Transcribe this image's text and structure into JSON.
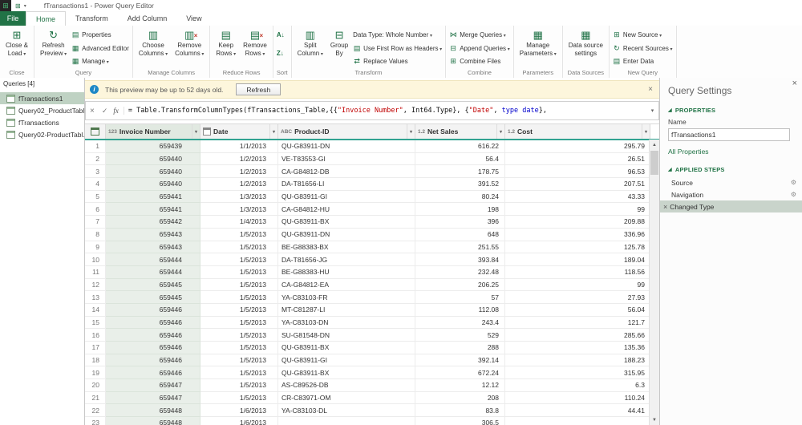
{
  "titlebar": {
    "title": "fTransactions1 - Power Query Editor"
  },
  "menu": {
    "file": "File",
    "tabs": [
      "Home",
      "Transform",
      "Add Column",
      "View"
    ],
    "active_tab": "Home"
  },
  "ribbon": {
    "close_load": [
      "Close &",
      "Load"
    ],
    "refresh_preview": [
      "Refresh",
      "Preview"
    ],
    "properties": "Properties",
    "advanced_editor": "Advanced Editor",
    "manage": "Manage",
    "choose_columns": [
      "Choose",
      "Columns"
    ],
    "remove_columns": [
      "Remove",
      "Columns"
    ],
    "keep_rows": [
      "Keep",
      "Rows"
    ],
    "remove_rows": [
      "Remove",
      "Rows"
    ],
    "split_column": [
      "Split",
      "Column"
    ],
    "group_by": [
      "Group",
      "By"
    ],
    "data_type": "Data Type: Whole Number",
    "use_first_row": "Use First Row as Headers",
    "replace_values": "Replace Values",
    "merge_queries": "Merge Queries",
    "append_queries": "Append Queries",
    "combine_files": "Combine Files",
    "manage_parameters": [
      "Manage",
      "Parameters"
    ],
    "data_source_settings": [
      "Data source",
      "settings"
    ],
    "new_source": "New Source",
    "recent_sources": "Recent Sources",
    "enter_data": "Enter Data",
    "group_labels": [
      "Close",
      "Query",
      "Manage Columns",
      "Reduce Rows",
      "Sort",
      "Transform",
      "Combine",
      "Parameters",
      "Data Sources",
      "New Query"
    ]
  },
  "sidebar": {
    "header": "Queries [4]",
    "items": [
      {
        "label": "fTransactions1",
        "selected": true
      },
      {
        "label": "Query02_ProductTabl...",
        "selected": false
      },
      {
        "label": "fTransactions",
        "selected": false
      },
      {
        "label": "Query02-ProductTabl...",
        "selected": false
      }
    ]
  },
  "notification": {
    "message": "This preview may be up to 52 days old.",
    "refresh_label": "Refresh"
  },
  "formula": {
    "segments": [
      {
        "cls": "plain",
        "text": "= Table.TransformColumnTypes(fTransactions_Table,{{"
      },
      {
        "cls": "string",
        "text": "\"Invoice Number\""
      },
      {
        "cls": "plain",
        "text": ", Int64.Type}, {"
      },
      {
        "cls": "string",
        "text": "\"Date\""
      },
      {
        "cls": "plain",
        "text": ", "
      },
      {
        "cls": "keyword",
        "text": "type date"
      },
      {
        "cls": "plain",
        "text": "},"
      }
    ]
  },
  "table": {
    "columns": [
      {
        "icon": "123",
        "label": "Invoice Number",
        "selected": true
      },
      {
        "icon": "cal",
        "label": "Date",
        "selected": false
      },
      {
        "icon": "ABC",
        "label": "Product-ID",
        "selected": false
      },
      {
        "icon": "1.2",
        "label": "Net Sales",
        "selected": false
      },
      {
        "icon": "1.2",
        "label": "Cost",
        "selected": false
      }
    ],
    "rows": [
      [
        "1",
        "659439",
        "1/1/2013",
        "QU-G83911-DN",
        "616.22",
        "295.79"
      ],
      [
        "2",
        "659440",
        "1/2/2013",
        "VE-T83553-GI",
        "56.4",
        "26.51"
      ],
      [
        "3",
        "659440",
        "1/2/2013",
        "CA-G84812-DB",
        "178.75",
        "96.53"
      ],
      [
        "4",
        "659440",
        "1/2/2013",
        "DA-T81656-LI",
        "391.52",
        "207.51"
      ],
      [
        "5",
        "659441",
        "1/3/2013",
        "QU-G83911-GI",
        "80.24",
        "43.33"
      ],
      [
        "6",
        "659441",
        "1/3/2013",
        "CA-G84812-HU",
        "198",
        "99"
      ],
      [
        "7",
        "659442",
        "1/4/2013",
        "QU-G83911-BX",
        "396",
        "209.88"
      ],
      [
        "8",
        "659443",
        "1/5/2013",
        "QU-G83911-DN",
        "648",
        "336.96"
      ],
      [
        "9",
        "659443",
        "1/5/2013",
        "BE-G88383-BX",
        "251.55",
        "125.78"
      ],
      [
        "10",
        "659444",
        "1/5/2013",
        "DA-T81656-JG",
        "393.84",
        "189.04"
      ],
      [
        "11",
        "659444",
        "1/5/2013",
        "BE-G88383-HU",
        "232.48",
        "118.56"
      ],
      [
        "12",
        "659445",
        "1/5/2013",
        "CA-G84812-EA",
        "206.25",
        "99"
      ],
      [
        "13",
        "659445",
        "1/5/2013",
        "YA-C83103-FR",
        "57",
        "27.93"
      ],
      [
        "14",
        "659446",
        "1/5/2013",
        "MT-C81287-LI",
        "112.08",
        "56.04"
      ],
      [
        "15",
        "659446",
        "1/5/2013",
        "YA-C83103-DN",
        "243.4",
        "121.7"
      ],
      [
        "16",
        "659446",
        "1/5/2013",
        "SU-G81548-DN",
        "529",
        "285.66"
      ],
      [
        "17",
        "659446",
        "1/5/2013",
        "QU-G83911-BX",
        "288",
        "135.36"
      ],
      [
        "18",
        "659446",
        "1/5/2013",
        "QU-G83911-GI",
        "392.14",
        "188.23"
      ],
      [
        "19",
        "659446",
        "1/5/2013",
        "QU-G83911-BX",
        "672.24",
        "315.95"
      ],
      [
        "20",
        "659447",
        "1/5/2013",
        "AS-C89526-DB",
        "12.12",
        "6.3"
      ],
      [
        "21",
        "659447",
        "1/5/2013",
        "CR-C83971-OM",
        "208",
        "110.24"
      ],
      [
        "22",
        "659448",
        "1/6/2013",
        "YA-C83103-DL",
        "83.8",
        "44.41"
      ],
      [
        "23",
        "659448",
        "1/6/2013",
        "",
        "306.5",
        ""
      ]
    ]
  },
  "settings": {
    "title": "Query Settings",
    "properties_header": "PROPERTIES",
    "name_label": "Name",
    "name_value": "fTransactions1",
    "all_properties": "All Properties",
    "applied_steps_header": "APPLIED STEPS",
    "steps": [
      {
        "label": "Source",
        "gear": true,
        "selected": false
      },
      {
        "label": "Navigation",
        "gear": true,
        "selected": false
      },
      {
        "label": "Changed Type",
        "gear": false,
        "selected": true
      }
    ]
  },
  "colors": {
    "brand_green": "#217346",
    "selection_teal": "#31a391",
    "selected_query_bg": "#bfd2c3",
    "warning_bg": "#fdf6dc"
  }
}
